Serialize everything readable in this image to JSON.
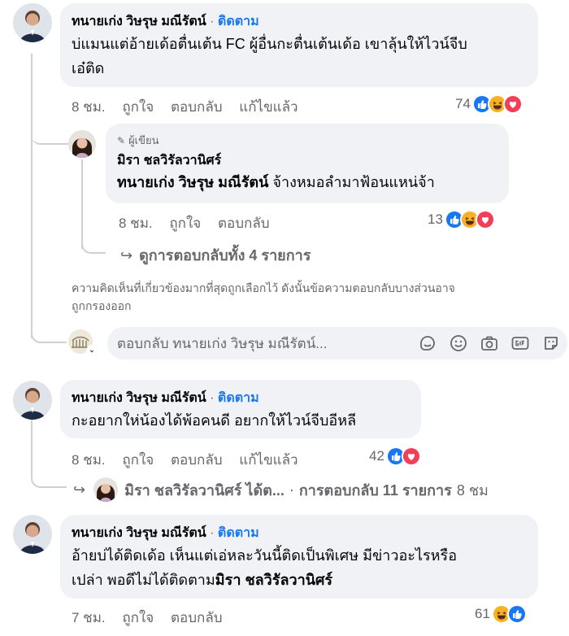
{
  "comments": [
    {
      "author": "ทนายเก่ง วิษรุษ มณีรัตน์",
      "dot": "·",
      "follow": "ติดตาม",
      "lines": [
        "บ่แมนแต่อ้ายเด้อตื่นเต้น FC ผู้อื่นกะตื่นเต้นเด้อ เขาลุ้นให้ไวน์จีบ",
        "เอ๋ติด"
      ],
      "time": "8 ชม.",
      "like": "ถูกใจ",
      "reply": "ตอบกลับ",
      "edited": "แก้ไขแล้ว",
      "reaction_count": "74"
    },
    {
      "author": "ทนายเก่ง วิษรุษ มณีรัตน์",
      "dot": "·",
      "follow": "ติดตาม",
      "line": "กะอยากให่น้องได้พ้อคนดี อยากให้ไวน์จีบอีหลี",
      "time": "8 ชม.",
      "like": "ถูกใจ",
      "reply": "ตอบกลับ",
      "edited": "แก้ไขแล้ว",
      "reaction_count": "42"
    },
    {
      "author": "ทนายเก่ง วิษรุษ มณีรัตน์",
      "dot": "·",
      "follow": "ติดตาม",
      "lines": [
        "อ้ายบ่ได้ติดเด้อ เห็นแต่เอ่หละวันนี้ติดเป็นพิเศษ มีข่าวอะไรหรือ",
        "เปล่า พอดีไม่ได้ติดตาม"
      ],
      "tag": "มิรา ชลวิรัลวานิศร์",
      "time": "7 ชม.",
      "like": "ถูกใจ",
      "reply": "ตอบกลับ",
      "reaction_count": "61"
    }
  ],
  "reply": {
    "author_label": "ผู้เขียน",
    "author": "มิรา ชลวิรัลวานิศร์",
    "tag": "ทนายเก่ง วิษรุษ มณีรัตน์",
    "text": "จ้างหมอลำมาฟ้อนแหน่จ้า",
    "time": "8 ชม.",
    "like": "ถูกใจ",
    "reply": "ตอบกลับ",
    "reaction_count": "13"
  },
  "view_replies": "ดูการตอบกลับทั้ง 4 รายการ",
  "note_lines": [
    "ความคิดเห็นที่เกี่ยวข้องมากที่สุดถูกเลือกไว้ ดังนั้นข้อความตอบกลับบางส่วนอาจ",
    "ถูกกรองออก"
  ],
  "reply_input_placeholder": "ตอบกลับ ทนายเก่ง วิษรุษ มณีรัตน์...",
  "inline_reply": {
    "name": "มิรา ชลวิรัลวานิศร์ ได้ต...",
    "dot": "·",
    "text": "การตอบกลับ 11 รายการ",
    "time": "8 ชม"
  },
  "colors": {
    "accent": "#1877f2",
    "bubble": "#f0f2f5",
    "muted": "#65676b"
  },
  "icons": [
    "like-reaction-icon",
    "haha-reaction-icon",
    "love-reaction-icon",
    "pencil-icon",
    "reply-arrow-icon",
    "sticker-icon",
    "emoji-icon",
    "camera-icon",
    "gif-icon",
    "avatar-sticker-icon"
  ]
}
